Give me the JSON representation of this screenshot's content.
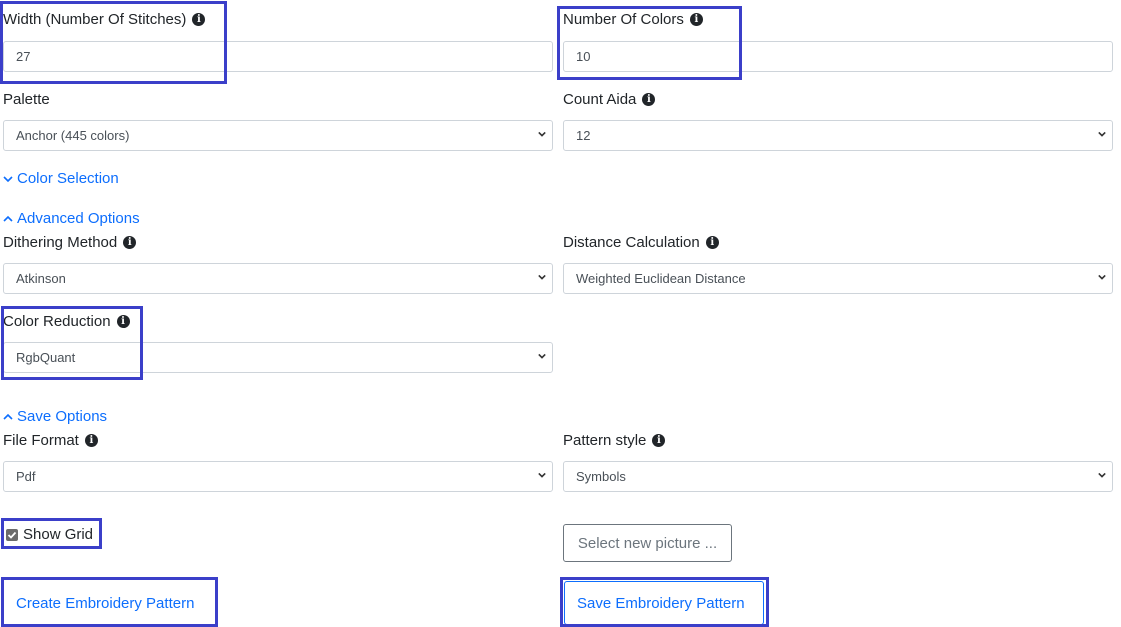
{
  "width_field": {
    "label": "Width (Number Of Stitches)",
    "value": "27"
  },
  "colors_field": {
    "label": "Number Of Colors",
    "value": "10"
  },
  "palette_field": {
    "label": "Palette",
    "value": "Anchor (445 colors)"
  },
  "count_aida_field": {
    "label": "Count Aida",
    "value": "12"
  },
  "sections": {
    "color_selection": "Color Selection",
    "advanced_options": "Advanced Options",
    "save_options": "Save Options"
  },
  "dithering_field": {
    "label": "Dithering Method",
    "value": "Atkinson"
  },
  "distance_field": {
    "label": "Distance Calculation",
    "value": "Weighted Euclidean Distance"
  },
  "color_reduction_field": {
    "label": "Color Reduction",
    "value": "RgbQuant"
  },
  "file_format_field": {
    "label": "File Format",
    "value": "Pdf"
  },
  "pattern_style_field": {
    "label": "Pattern style",
    "value": "Symbols"
  },
  "show_grid": {
    "label": "Show Grid",
    "checked": true
  },
  "buttons": {
    "select_picture": "Select new picture ...",
    "create_pattern": "Create Embroidery Pattern",
    "save_pattern": "Save Embroidery Pattern"
  },
  "colors": {
    "link": "#0d6efd",
    "highlight": "#3b3fc9"
  }
}
